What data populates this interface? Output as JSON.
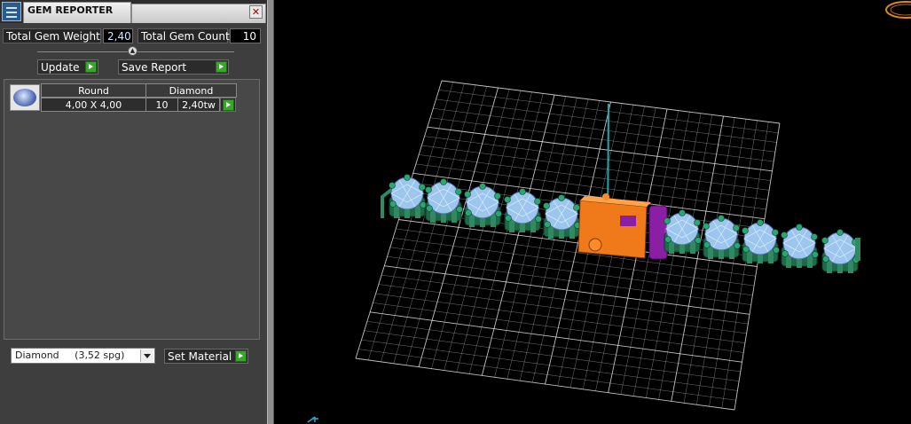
{
  "window": {
    "title": "GEM REPORTER",
    "close_glyph": "✕"
  },
  "stats": {
    "total_weight_label": "Total Gem Weight",
    "total_weight_value": "2,40",
    "total_count_label": "Total Gem Count",
    "total_count_value": "10"
  },
  "toolbar": {
    "update_label": "Update",
    "save_report_label": "Save Report"
  },
  "gem_table": {
    "headers": [
      "Round",
      "Diamond"
    ],
    "rows": [
      {
        "size": "4,00 X 4,00",
        "count": "10",
        "weight": "2,40tw"
      }
    ]
  },
  "material": {
    "selected": "Diamond     (3,52 spg)",
    "set_material_label": "Set Material"
  },
  "icons": {
    "app": "gem-reporter-app-icon",
    "close": "close-icon",
    "go": "green-play-icon",
    "thumb": "round-gem-icon",
    "axis": "axis-gizmo-icon",
    "nav": "view-navigator-icon"
  },
  "colors": {
    "panel_bg": "#3e3e3e",
    "viewport_bg": "#000000",
    "accent_green": "#3aa52c",
    "grid": "#ffffff",
    "casting_green": "#1f6b49",
    "gem_blue": "#9cc6ee",
    "clasp_orange": "#f07a1a",
    "clasp_purple": "#8a1ea5"
  }
}
